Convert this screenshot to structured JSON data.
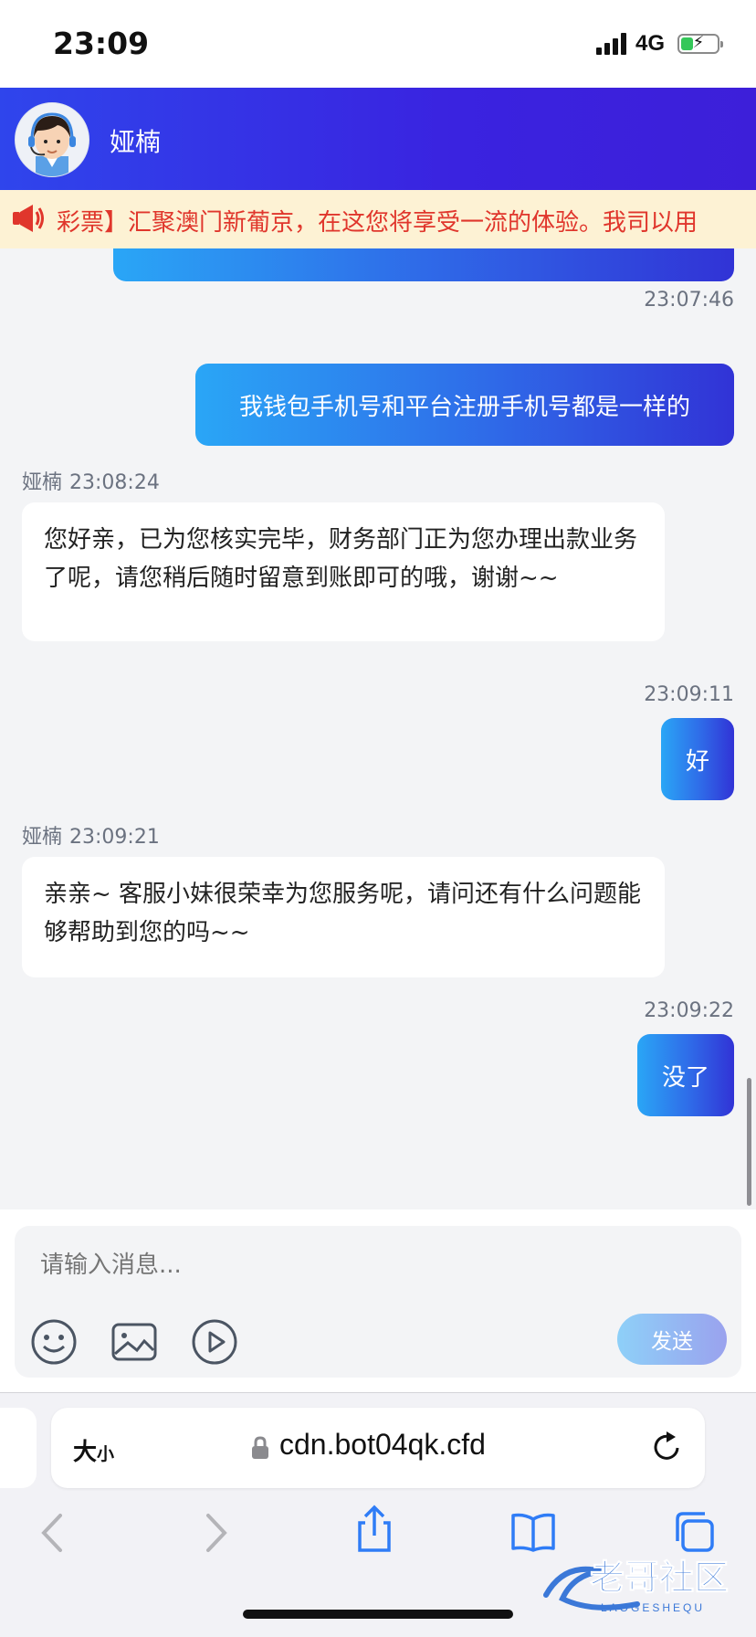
{
  "status_bar": {
    "time": "23:09",
    "network": "4G",
    "battery_level": 0.35,
    "battery_color": "#34c759"
  },
  "header": {
    "agent_name": "娅楠",
    "gradient_start": "#2f45ec",
    "gradient_end": "#3d1fd9"
  },
  "announcement": {
    "text": "彩票】汇聚澳门新葡京，在这您将享受一流的体验。我司以用",
    "icon": "megaphone-icon",
    "color": "#e0362c"
  },
  "messages": [
    {
      "id": "m1",
      "sender": "user",
      "time": "23:07:46",
      "text": "我钱包手机号和平台注册手机号都是一样的"
    },
    {
      "id": "m2",
      "sender": "agent",
      "name": "娅楠",
      "time": "23:08:24",
      "text": "您好亲，已为您核实完毕，财务部门正为您办理出款业务了呢，请您稍后随时留意到账即可的哦，谢谢~~"
    },
    {
      "id": "m3",
      "sender": "user",
      "time": "23:09:11",
      "text": "好"
    },
    {
      "id": "m4",
      "sender": "agent",
      "name": "娅楠",
      "time": "23:09:21",
      "text": "亲亲~ 客服小妹很荣幸为您服务呢，请问还有什么问题能够帮助到您的吗~~"
    },
    {
      "id": "m5",
      "sender": "user",
      "time": "23:09:22",
      "text": "没了"
    }
  ],
  "composer": {
    "placeholder": "请输入消息...",
    "send_label": "发送",
    "tools": [
      "emoji-icon",
      "image-icon",
      "video-icon"
    ]
  },
  "browser": {
    "text_size_label": "大",
    "text_size_small": "小",
    "url": "cdn.bot04qk.cfd"
  },
  "watermark": {
    "text": "老哥社区",
    "subtext": "LAOGESHEQU"
  }
}
